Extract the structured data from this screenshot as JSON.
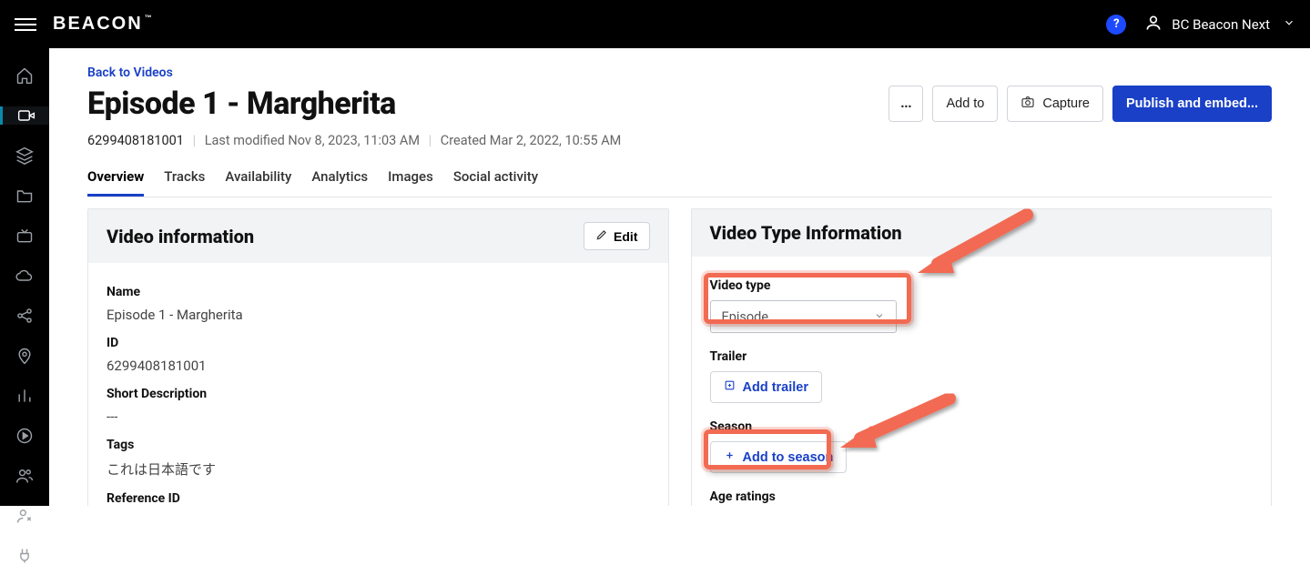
{
  "header": {
    "brand": "BEACON",
    "user_name": "BC Beacon Next",
    "help_label": "?"
  },
  "page": {
    "back_link": "Back to Videos",
    "title": "Episode 1 - Margherita",
    "video_id": "6299408181001",
    "modified_label": "Last modified Nov 8, 2023, 11:03 AM",
    "created_label": "Created Mar 2, 2022, 10:55 AM"
  },
  "actions": {
    "more": "...",
    "add_to": "Add to",
    "capture": "Capture",
    "publish": "Publish and embed..."
  },
  "tabs": [
    "Overview",
    "Tracks",
    "Availability",
    "Analytics",
    "Images",
    "Social activity"
  ],
  "video_info": {
    "panel_title": "Video information",
    "edit_label": "Edit",
    "name_label": "Name",
    "name_value": "Episode 1 - Margherita",
    "id_label": "ID",
    "id_value": "6299408181001",
    "short_desc_label": "Short Description",
    "short_desc_value": "---",
    "tags_label": "Tags",
    "tags_value": "これは日本語です",
    "ref_id_label": "Reference ID"
  },
  "type_info": {
    "panel_title": "Video Type Information",
    "video_type_label": "Video type",
    "video_type_value": "Episode",
    "trailer_label": "Trailer",
    "add_trailer": "Add trailer",
    "season_label": "Season",
    "add_to_season": "Add to season",
    "age_ratings_label": "Age ratings"
  }
}
